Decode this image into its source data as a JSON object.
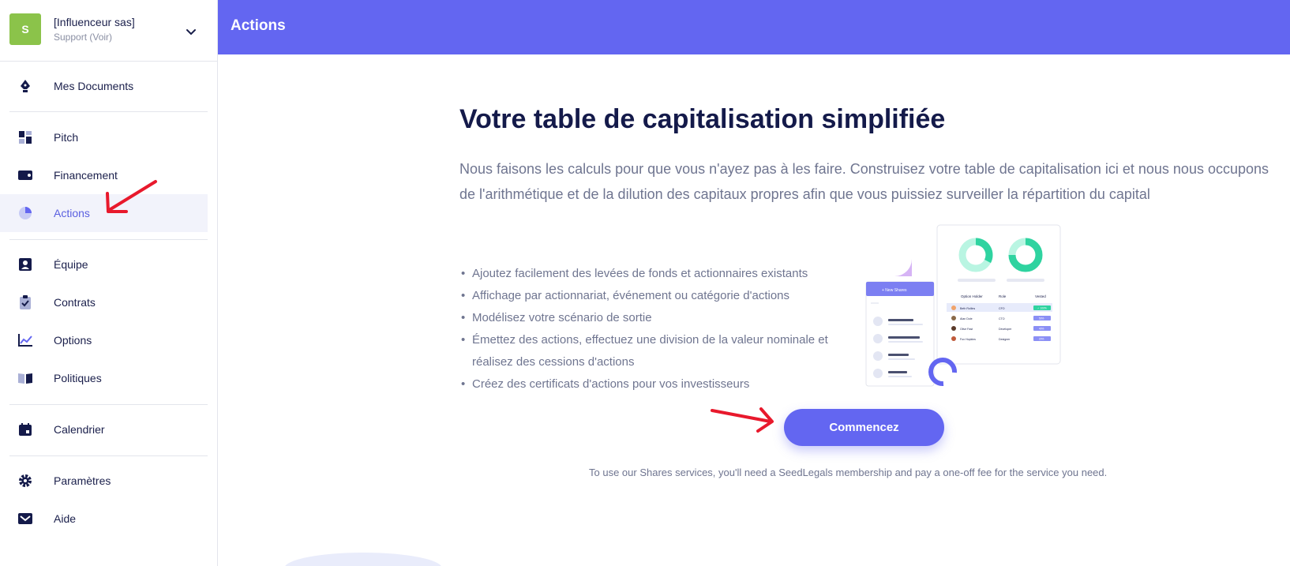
{
  "org": {
    "avatar_letter": "S",
    "name": "[Influenceur sas]",
    "role": "Support (Voir)"
  },
  "nav": {
    "documents": "Mes Documents",
    "pitch": "Pitch",
    "financement": "Financement",
    "actions": "Actions",
    "equipe": "Équipe",
    "contrats": "Contrats",
    "options": "Options",
    "politiques": "Politiques",
    "calendrier": "Calendrier",
    "parametres": "Paramètres",
    "aide": "Aide"
  },
  "header": {
    "title": "Actions"
  },
  "main": {
    "title": "Votre table de capitalisation simplifiée",
    "lead": "Nous faisons les calculs pour que vous n'ayez pas à les faire. Construisez votre table de capitalisation ici et nous nous occupons de l'arithmétique et de la dilution des capitaux propres afin que vous puissiez surveiller la répartition du capital",
    "bullets": [
      "Ajoutez facilement des levées de fonds et actionnaires existants",
      "Affichage par actionnariat, événement ou catégorie d'actions",
      "Modélisez votre scénario de sortie",
      "Émettez des actions, effectuez une division de la valeur nominale et réalisez des cessions d'actions",
      "Créez des certificats d'actions pour vos investisseurs"
    ],
    "cta": "Commencez",
    "footnote": "To use our Shares services, you'll need a SeedLegals membership and pay a one-off fee for the service you need."
  },
  "illustration": {
    "new_shares": "+ New Shares",
    "columns": [
      "Option Holder",
      "Role",
      "Vested"
    ],
    "rows": [
      {
        "name": "Beth Rollins",
        "role": "CFO",
        "vested": "✓ 100%"
      },
      {
        "name": "Alan Dole",
        "role": "CTO",
        "vested": "50%"
      },
      {
        "name": "Olive Fast",
        "role": "Developer",
        "vested": "40%"
      },
      {
        "name": "Fox Hopkins",
        "role": "Designer",
        "vested": "20%"
      }
    ]
  },
  "colors": {
    "accent": "#6366f1",
    "brand_avatar": "#8bc34a",
    "annotation_arrow": "#e8192c"
  }
}
